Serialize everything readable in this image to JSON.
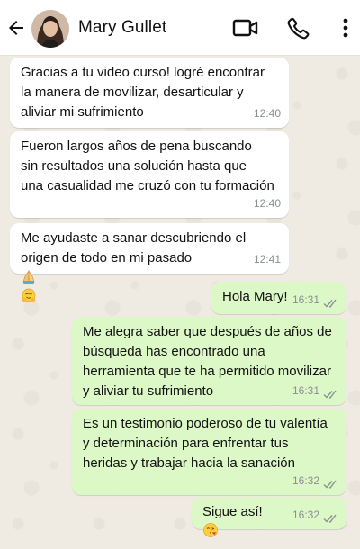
{
  "header": {
    "contact_name": "Mary Gullet",
    "icons": [
      "back-arrow-icon",
      "avatar",
      "video-call-icon",
      "phone-icon",
      "more-options-icon"
    ]
  },
  "messages": [
    {
      "direction": "incoming",
      "text": "Gracias a tu video curso! logré encontrar\nla manera de movilizar, desarticular y\naliviar mi sufrimiento",
      "time": "12:40"
    },
    {
      "direction": "incoming",
      "text": "Fueron largos años de pena buscando\nsin resultados una solución hasta que\nuna casualidad me cruzó con tu formación",
      "time": "12:40"
    },
    {
      "direction": "incoming",
      "text": "Me ayudaste a sanar descubriendo el\norigen de todo en mi pasado",
      "emojis": [
        "folded-hands-emoji",
        "hugging-face-emoji"
      ],
      "time": "12:41"
    },
    {
      "direction": "outgoing",
      "text": "Hola Mary!",
      "time": "16:31",
      "status": "read"
    },
    {
      "direction": "outgoing",
      "text": "Me alegra saber que después de años de\nbúsqueda has encontrado una\nherramienta que te ha permitido movilizar\ny aliviar tu sufrimiento",
      "time": "16:31",
      "status": "read"
    },
    {
      "direction": "outgoing",
      "text": "Es un testimonio poderoso de tu valentía\ny determinación para enfrentar tus\nheridas y trabajar hacia la sanación",
      "time": "16:32",
      "status": "read"
    },
    {
      "direction": "outgoing",
      "text": "Sigue así!",
      "emojis": [
        "face-blowing-kiss-emoji"
      ],
      "time": "16:32",
      "status": "read"
    }
  ],
  "colors": {
    "chat_background": "#efeae2",
    "incoming_bubble": "#ffffff",
    "outgoing_bubble": "#dcf8c6",
    "timestamp": "#8a8f94"
  }
}
